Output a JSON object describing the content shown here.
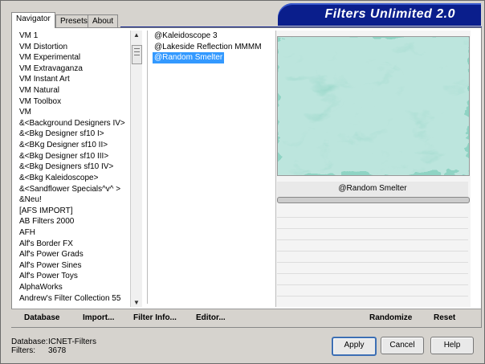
{
  "tabs": [
    "Navigator",
    "Presets",
    "About"
  ],
  "banner_title": "Filters Unlimited 2.0",
  "categories": [
    "VM 1",
    "VM Distortion",
    "VM Experimental",
    "VM Extravaganza",
    "VM Instant Art",
    "VM Natural",
    "VM Toolbox",
    "VM",
    "&<Background Designers IV>",
    "&<Bkg Designer sf10 I>",
    "&<BKg Designer sf10 II>",
    "&<Bkg Designer sf10 III>",
    "&<Bkg Designers sf10 IV>",
    "&<Bkg Kaleidoscope>",
    "&<Sandflower Specials^v^ >",
    "&Neu!",
    "[AFS IMPORT]",
    "AB Filters 2000",
    "AFH",
    "Alf's Border FX",
    "Alf's Power Grads",
    "Alf's Power Sines",
    "Alf's Power Toys",
    "AlphaWorks",
    "Andrew's Filter Collection 55"
  ],
  "filters": [
    "@Kaleidoscope 3",
    "@Lakeside Reflection MMMM",
    "@Random Smelter"
  ],
  "selected_filter": "@Random Smelter",
  "bottom_links": {
    "database": "Database",
    "import": "Import...",
    "filter_info": "Filter Info...",
    "editor": "Editor...",
    "randomize": "Randomize",
    "reset": "Reset"
  },
  "status": {
    "database_label": "Database:",
    "database_value": "ICNET-Filters",
    "filters_label": "Filters:",
    "filters_value": "3678"
  },
  "buttons": {
    "apply": "Apply",
    "cancel": "Cancel",
    "help": "Help"
  },
  "colors": {
    "banner": "#0a1e8c",
    "selection": "#3399ff"
  }
}
